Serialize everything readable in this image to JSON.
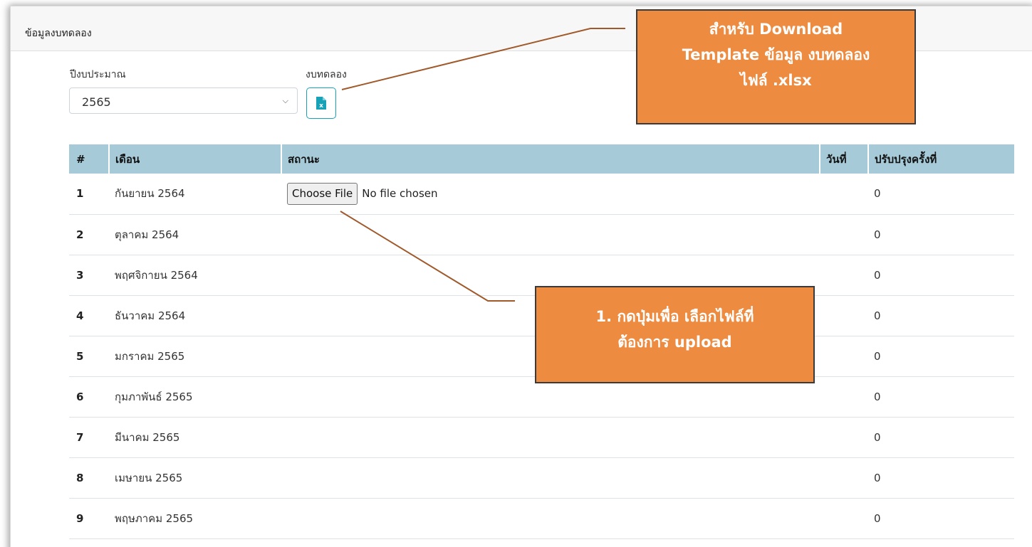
{
  "card": {
    "title": "ข้อมูลงบทดลอง"
  },
  "filters": {
    "year_label": "ปีงบประมาณ",
    "year_value": "2565",
    "budget_label": "งบทดลอง",
    "download_icon": "excel-file-icon"
  },
  "table": {
    "headers": [
      "#",
      "เดือน",
      "สถานะ",
      "วันที่",
      "ปรับปรุงครั้งที่"
    ],
    "file_button_label": "Choose File",
    "file_none_text": "No file chosen",
    "rows": [
      {
        "no": "1",
        "month": "กันยายน 2564",
        "revision": "0"
      },
      {
        "no": "2",
        "month": "ตุลาคม 2564",
        "revision": "0"
      },
      {
        "no": "3",
        "month": "พฤศจิกายน 2564",
        "revision": "0"
      },
      {
        "no": "4",
        "month": "ธันวาคม 2564",
        "revision": "0"
      },
      {
        "no": "5",
        "month": "มกราคม 2565",
        "revision": "0"
      },
      {
        "no": "6",
        "month": "กุมภาพันธ์ 2565",
        "revision": "0"
      },
      {
        "no": "7",
        "month": "มีนาคม 2565",
        "revision": "0"
      },
      {
        "no": "8",
        "month": "เมษายน 2565",
        "revision": "0"
      },
      {
        "no": "9",
        "month": "พฤษภาคม 2565",
        "revision": "0"
      }
    ]
  },
  "callouts": {
    "download": {
      "line1": "สำหรับ Download",
      "line2": "Template ข้อมูล งบทดลอง",
      "line3": "ไฟล์ .xlsx"
    },
    "upload": {
      "line1": "1. กดปุ่มเพื่อ เลือกไฟล์ที่",
      "line2": "ต้องการ upload"
    }
  },
  "colors": {
    "table_header_bg": "#a6cad8",
    "callout_bg": "#ed8b40",
    "leader_line": "#a0592a",
    "download_button_border": "#17a2b8"
  }
}
